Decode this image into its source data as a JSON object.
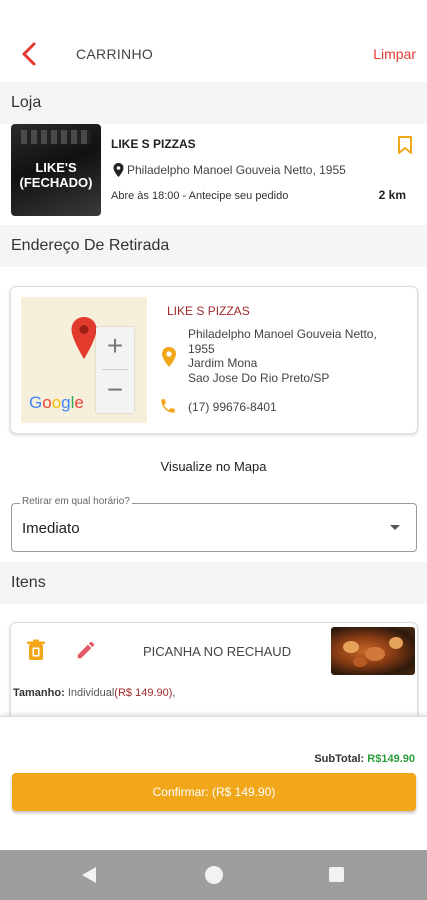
{
  "header": {
    "title": "CARRINHO",
    "clear_label": "Limpar",
    "accent_color": "#e53935"
  },
  "sections": {
    "store": "Loja",
    "pickup": "Endereço De Retirada",
    "items": "Itens"
  },
  "store": {
    "image_text": "LIKE'S (FECHADO)",
    "name": "LIKE S PIZZAS",
    "address": "Philadelpho Manoel Gouveia Netto, 1955",
    "hours": "Abre às 18:00 - Antecipe seu pedido",
    "distance": "2 km",
    "bookmark_icon": "bookmark-icon"
  },
  "pickup": {
    "map_brand": "Google",
    "name": "LIKE S PIZZAS",
    "address_lines": [
      "Philadelpho Manoel Gouveia Netto,",
      "1955",
      "Jardim Mona",
      "Sao Jose Do Rio Preto/SP"
    ],
    "phone": "(17) 99676-8401",
    "view_map": "Visualize no Mapa"
  },
  "time_select": {
    "label": "Retirar em qual horário?",
    "value": "Imediato"
  },
  "item": {
    "name": "PICANHA NO RECHAUD",
    "size_label": "Tamanho:",
    "size_value": "Individual",
    "size_price": "(R$ 149.90)",
    "size_suffix": ","
  },
  "footer": {
    "subtotal_label": "SubTotal:",
    "subtotal_value": "R$149.90",
    "confirm_label": "Confirmar: (R$ 149.90)",
    "confirm_color": "#f2a71b",
    "subtotal_color": "#2e9e3a"
  }
}
